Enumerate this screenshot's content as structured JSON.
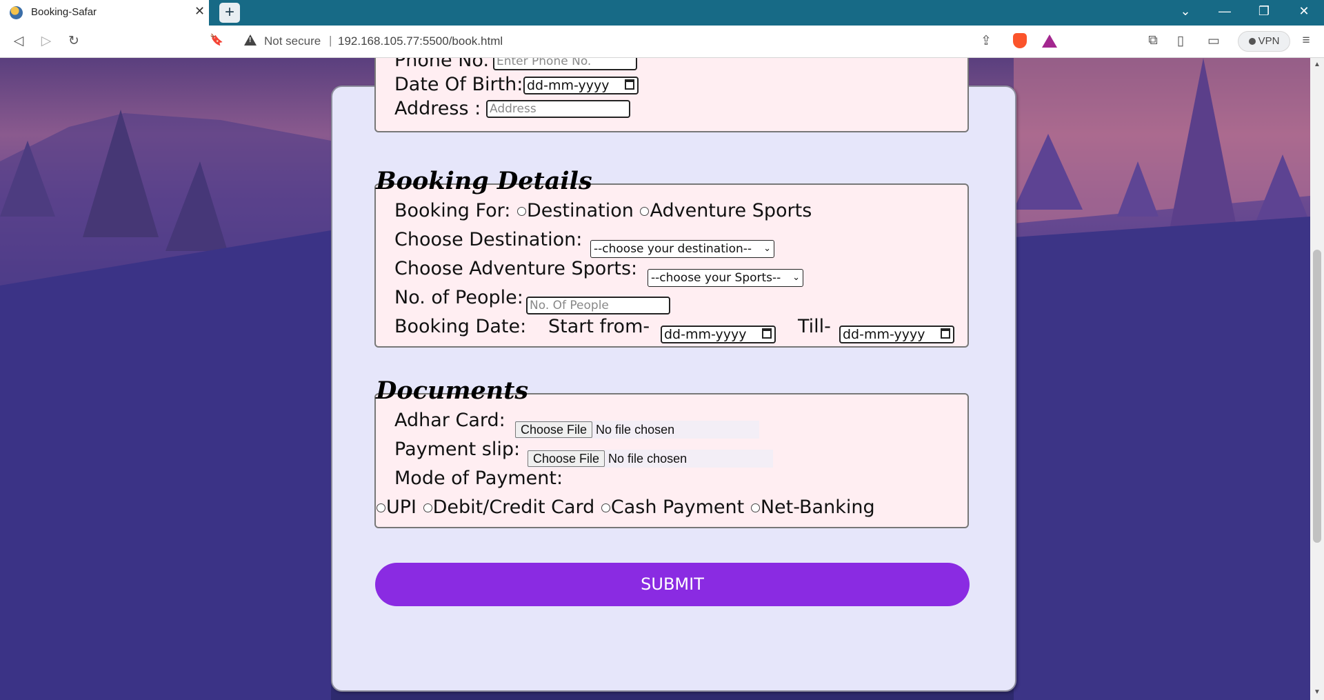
{
  "browser": {
    "tab_title": "Booking-Safar",
    "tab_close": "✕",
    "new_tab": "+",
    "window_controls": {
      "list": "⌄",
      "minimize": "—",
      "restore": "❐",
      "close": "✕"
    },
    "nav": {
      "back": "◁",
      "forward": "▷",
      "reload": "↻",
      "bookmark": "🔖"
    },
    "security_label": "Not secure",
    "separator": "|",
    "url": "192.168.105.77:5500/book.html",
    "share_icon": "⇪",
    "extensions_icon": "⧉",
    "sidebar_icon": "▯",
    "wallet_icon": "▭",
    "vpn_label": "VPN",
    "menu_icon": "≡"
  },
  "personal": {
    "phone_label": "Phone No.",
    "phone_placeholder": "Enter Phone No.",
    "dob_label": "Date Of Birth:",
    "dob_value": "dd-mm-yyyy",
    "address_label": "Address :",
    "address_placeholder": "Address"
  },
  "booking": {
    "legend": "Booking Details",
    "booking_for_label": "Booking For:",
    "option_destination": "Destination",
    "option_adventure": "Adventure Sports",
    "destination_label": "Choose Destination:",
    "destination_select": "--choose your destination--",
    "sports_label": "Choose Adventure Sports:",
    "sports_select": "--choose your Sports--",
    "people_label": "No. of People:",
    "people_placeholder": "No. Of People",
    "date_label": "Booking Date:",
    "start_label": "Start from-",
    "start_value": "dd-mm-yyyy",
    "till_label": "Till-",
    "till_value": "dd-mm-yyyy"
  },
  "documents": {
    "legend": "Documents",
    "adhar_label": "Adhar Card:",
    "payment_slip_label": "Payment slip:",
    "choose_file": "Choose File",
    "no_file": "No file chosen",
    "mode_label": "Mode of Payment:",
    "modes": [
      "UPI",
      "Debit/Credit Card",
      "Cash Payment",
      "Net-Banking"
    ]
  },
  "submit_label": "SUBMIT",
  "colors": {
    "accent": "#8a2be2",
    "card_bg": "#e6e6fa",
    "section_bg": "#ffeef2",
    "titlebar": "#176a86"
  }
}
